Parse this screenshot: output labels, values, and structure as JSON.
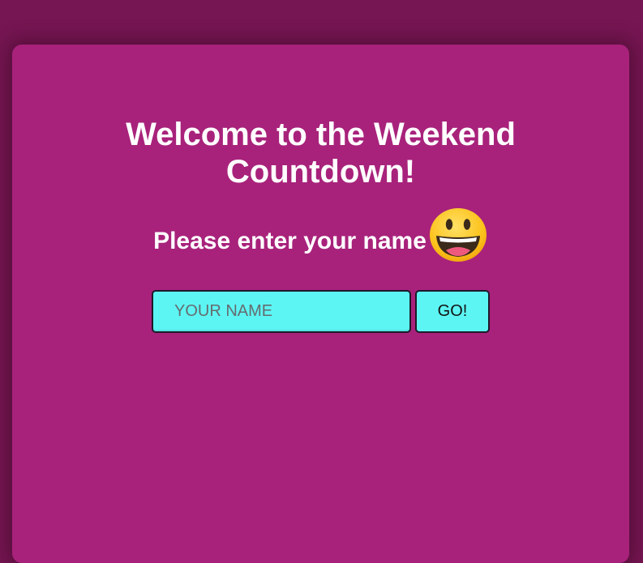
{
  "welcome": {
    "title_line1": "Welcome to the Weekend",
    "title_line2": "Countdown!"
  },
  "name_prompt": {
    "label": "Please enter your name",
    "emoji_icon": "grinning-face-emoji"
  },
  "name_form": {
    "input_value": "",
    "input_placeholder": "YOUR NAME",
    "submit_label": "GO!"
  },
  "colors": {
    "page_background": "#761652",
    "card_background": "#a8227b",
    "input_background": "#5cf5f3",
    "text": "#ffffff"
  }
}
